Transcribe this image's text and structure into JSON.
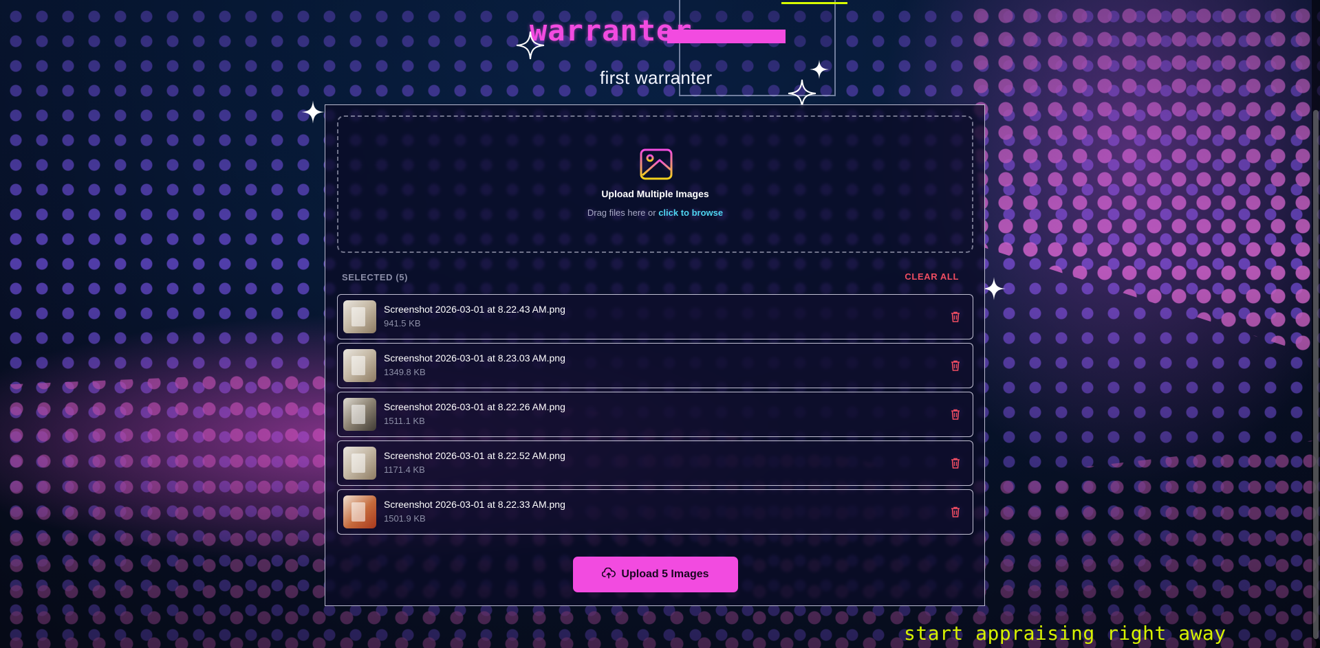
{
  "header": {
    "title": "warranter",
    "subtitle": "first warranter"
  },
  "dropzone": {
    "icon": "image-icon",
    "title": "Upload Multiple Images",
    "hint_prefix": "Drag files here or",
    "browse_link": "click to browse"
  },
  "selection": {
    "label": "SELECTED (5)",
    "clear_label": "CLEAR ALL"
  },
  "files": [
    {
      "name": "Screenshot 2026-03-01 at 8.22.43 AM.png",
      "size": "941.5 KB"
    },
    {
      "name": "Screenshot 2026-03-01 at 8.23.03 AM.png",
      "size": "1349.8 KB"
    },
    {
      "name": "Screenshot 2026-03-01 at 8.22.26 AM.png",
      "size": "1511.1 KB"
    },
    {
      "name": "Screenshot 2026-03-01 at 8.22.52 AM.png",
      "size": "1171.4 KB"
    },
    {
      "name": "Screenshot 2026-03-01 at 8.22.33 AM.png",
      "size": "1501.9 KB"
    }
  ],
  "upload_button": {
    "icon": "cloud-upload-icon",
    "label": "Upload 5 Images"
  },
  "tagline": "start appraising right away",
  "colors": {
    "accent": "#f24be0",
    "link": "#4fd5f2",
    "danger": "#f04d62",
    "tagline": "#d7f200"
  }
}
